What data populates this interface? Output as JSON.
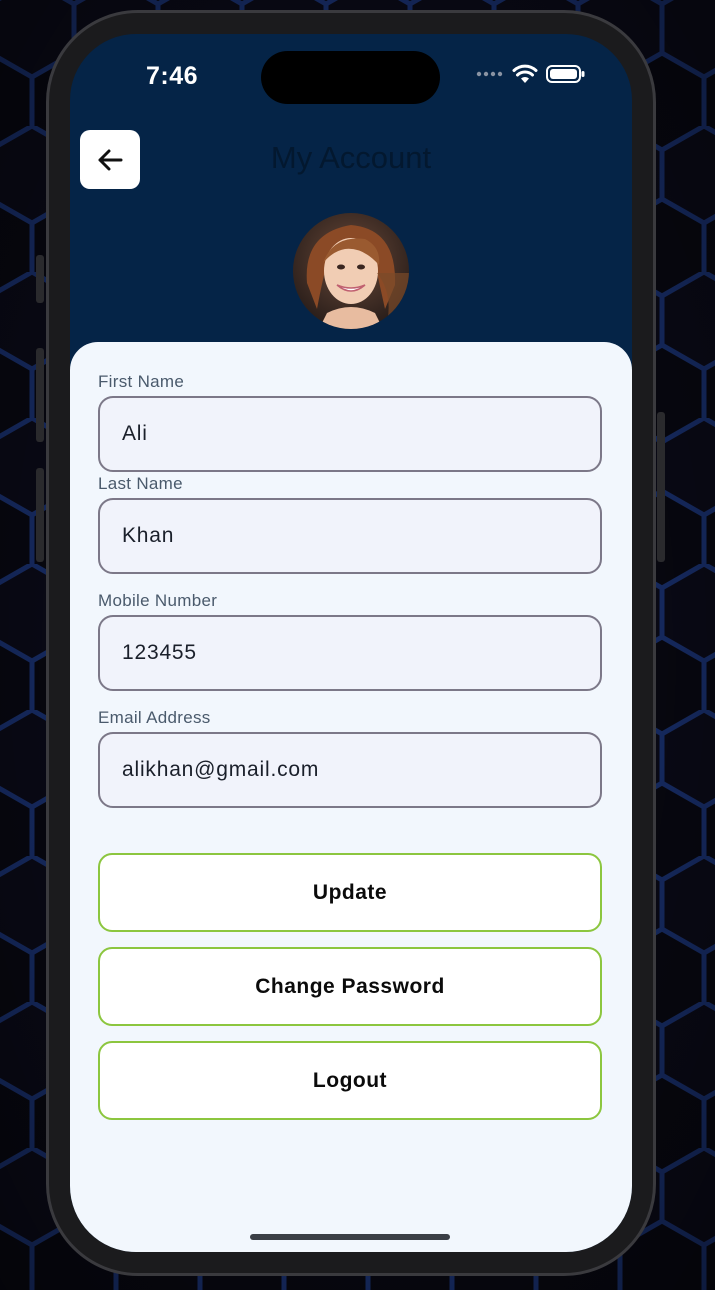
{
  "status_bar": {
    "time": "7:46",
    "icons": [
      "signal-dots-icon",
      "wifi-icon",
      "battery-icon"
    ]
  },
  "header": {
    "title": "My Account",
    "back_icon": "arrow-left-icon"
  },
  "profile": {
    "avatar": "profile-photo"
  },
  "form": {
    "first_name": {
      "label": "First Name",
      "value": "Ali"
    },
    "last_name": {
      "label": "Last Name",
      "value": "Khan"
    },
    "mobile": {
      "label": "Mobile Number",
      "value": "123455"
    },
    "email": {
      "label": "Email Address",
      "value": "alikhan@gmail.com"
    }
  },
  "actions": {
    "update": "Update",
    "change_password": "Change Password",
    "logout": "Logout"
  },
  "colors": {
    "header_bg": "#052447",
    "sheet_bg": "#f2f7fd",
    "button_border": "#8cc63f",
    "field_border": "#7c7888"
  }
}
